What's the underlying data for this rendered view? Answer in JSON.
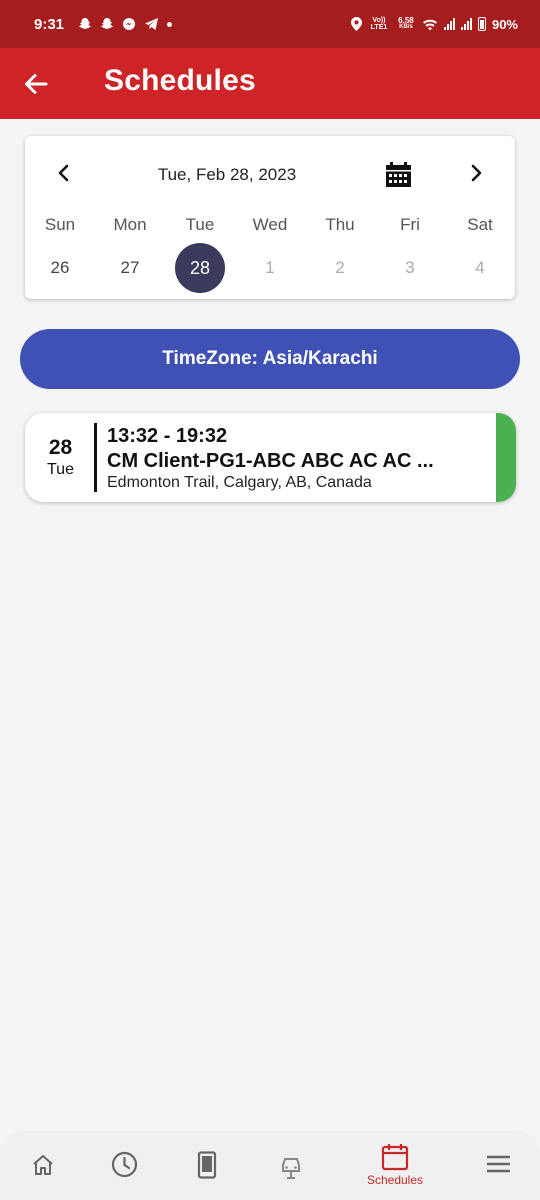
{
  "status_bar": {
    "time": "9:31",
    "network_label": "Vo)) LTE1",
    "speed_value": "6.58",
    "speed_unit": "KB/s",
    "battery": "90%"
  },
  "app_bar": {
    "title": "Schedules",
    "back_icon": "arrow-left-icon"
  },
  "calendar": {
    "current_date": "Tue, Feb 28, 2023",
    "weekdays": [
      "Sun",
      "Mon",
      "Tue",
      "Wed",
      "Thu",
      "Fri",
      "Sat"
    ],
    "days": [
      "26",
      "27",
      "28",
      "1",
      "2",
      "3",
      "4"
    ],
    "selected_index": 2
  },
  "timezone": {
    "label": "TimeZone: Asia/Karachi"
  },
  "schedules": [
    {
      "day_num": "28",
      "day_name": "Tue",
      "time": "13:32 - 19:32",
      "client": "CM Client-PG1-ABC ABC AC AC ...",
      "address": "Edmonton Trail, Calgary, AB, Canada",
      "status_color": "#4caf50"
    }
  ],
  "bottom_nav": {
    "items": [
      "home-icon",
      "clock-icon",
      "phone-icon",
      "car-icon",
      "calendar-icon",
      "menu-icon"
    ],
    "active_label": "Schedules"
  },
  "colors": {
    "status_bar": "#a51d1d",
    "app_bar": "#cf2427",
    "timezone_pill": "#3f51b5",
    "selected_day": "#3a3b5c",
    "active_nav": "#c62828"
  }
}
